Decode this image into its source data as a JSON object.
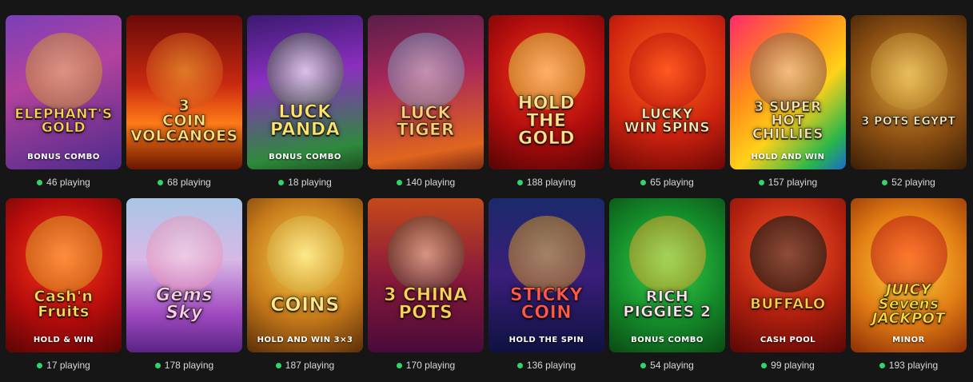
{
  "games": [
    {
      "title": "ELEPHANT'S\nGOLD",
      "subtitle": "BONUS COMBO",
      "players": "46 playing"
    },
    {
      "title": "3\nCOIN\nVOLCANOES",
      "subtitle": "",
      "players": "68 playing"
    },
    {
      "title": "LUCK\nPANDA",
      "subtitle": "BONUS COMBO",
      "players": "18 playing"
    },
    {
      "title": "LUCK\nTIGER",
      "subtitle": "",
      "players": "140 playing"
    },
    {
      "title": "HOLD\nTHE GOLD",
      "subtitle": "",
      "players": "188 playing"
    },
    {
      "title": "LUCKY\nWIN SPINS",
      "subtitle": "",
      "players": "65 playing"
    },
    {
      "title": "3 SUPER HOT\nCHILLIES",
      "subtitle": "HOLD AND WIN",
      "players": "157 playing"
    },
    {
      "title": "3 POTS EGYPT",
      "subtitle": "",
      "players": "52 playing"
    },
    {
      "title": "Cash'n\nFruits",
      "subtitle": "HOLD & WIN",
      "players": "17 playing"
    },
    {
      "title": "Gems\nSky",
      "subtitle": "",
      "players": "178 playing"
    },
    {
      "title": "COINS",
      "subtitle": "HOLD AND WIN 3×3",
      "players": "187 playing"
    },
    {
      "title": "3 CHINA\nPOTS",
      "subtitle": "",
      "players": "170 playing"
    },
    {
      "title": "STICKY\nCOIN",
      "subtitle": "HOLD THE SPIN",
      "players": "136 playing"
    },
    {
      "title": "RICH\nPIGGIES 2",
      "subtitle": "BONUS COMBO",
      "players": "54 playing"
    },
    {
      "title": "BUFFALO",
      "subtitle": "CASH POOL",
      "players": "99 playing"
    },
    {
      "title": "JUICY\nSevens\nJACKPOT",
      "subtitle": "MINOR",
      "players": "193 playing"
    }
  ]
}
